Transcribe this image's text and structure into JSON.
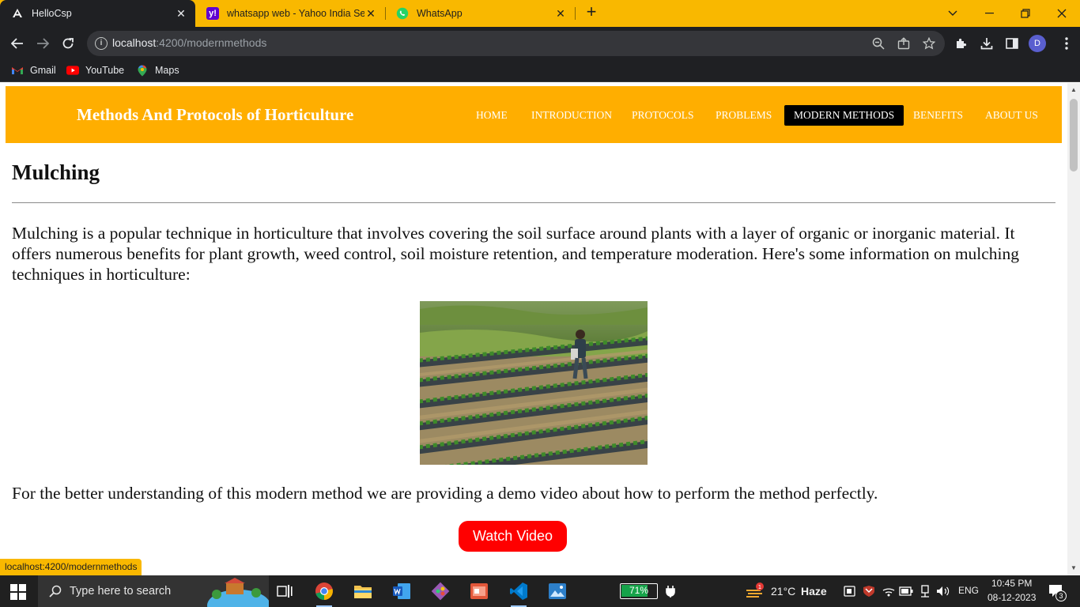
{
  "browser": {
    "tabs": [
      {
        "title": "HelloCsp",
        "favicon": "angular-icon",
        "active": true
      },
      {
        "title": "whatsapp web - Yahoo India Search Results",
        "favicon": "yahoo-icon",
        "active": false
      },
      {
        "title": "WhatsApp",
        "favicon": "whatsapp-icon",
        "active": false
      }
    ],
    "new_tab_label": "+",
    "close_glyph": "✕",
    "url_host": "localhost",
    "url_rest": ":4200/modernmethods",
    "avatar_letter": "D",
    "bookmarks": [
      {
        "label": "Gmail",
        "icon": "gmail-icon"
      },
      {
        "label": "YouTube",
        "icon": "youtube-icon"
      },
      {
        "label": "Maps",
        "icon": "maps-icon"
      }
    ],
    "status_url": "localhost:4200/modernmethods"
  },
  "site": {
    "title": "Methods And Protocols of Horticulture",
    "nav": [
      {
        "label": "HOME",
        "active": false
      },
      {
        "label": "INTRODUCTION",
        "active": false
      },
      {
        "label": "PROTOCOLS",
        "active": false
      },
      {
        "label": "PROBLEMS",
        "active": false
      },
      {
        "label": "MODERN METHODS",
        "active": true
      },
      {
        "label": "BENEFITS",
        "active": false
      },
      {
        "label": "ABOUT US",
        "active": false
      }
    ],
    "colors": {
      "header": "#ffae00",
      "active_nav": "#000000",
      "button": "#ff0000"
    }
  },
  "content": {
    "heading": "Mulching",
    "intro": "Mulching is a popular technique in horticulture that involves covering the soil surface around plants with a layer of organic or inorganic material. It offers numerous benefits for plant growth, weed control, soil moisture retention, and temperature moderation. Here's some information on mulching techniques in horticulture:",
    "video_note": "For the better understanding of this modern method we are providing a demo video about how to perform the method perfectly.",
    "watch_button": "Watch Video"
  },
  "taskbar": {
    "search_placeholder": "Type here to search",
    "battery": "71%",
    "weather_temp": "21°C",
    "weather_desc": "Haze",
    "weather_badge": "1",
    "language": "ENG",
    "time": "10:45 PM",
    "date": "08-12-2023",
    "notification_count": "3"
  }
}
